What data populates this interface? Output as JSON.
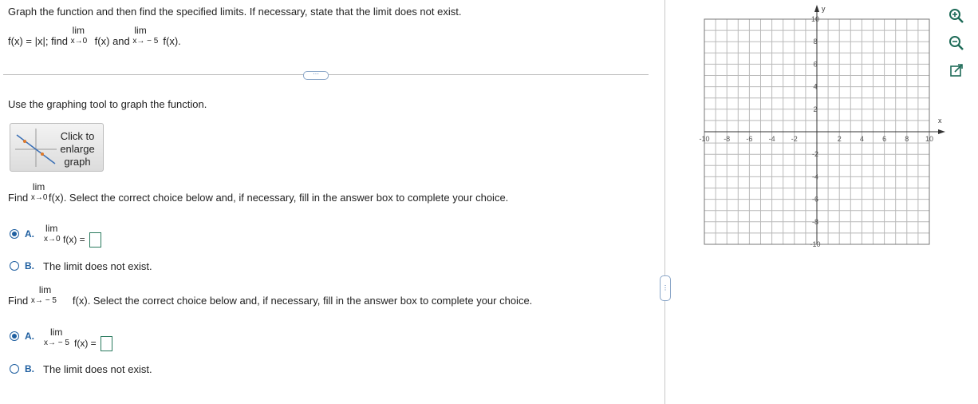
{
  "question": {
    "instruction": "Graph the function and then find the specified limits. If necessary, state that the limit does not exist.",
    "func_prefix": "f(x) = |x|; find",
    "lim_word": "lim",
    "fx": "f(x)",
    "and_word": "and",
    "fx_end": "f(x).",
    "approach_0": "x→0",
    "approach_m5": "x→ − 5"
  },
  "divider_label": "···",
  "graph_tool_text": "Use the graphing tool to graph the function.",
  "thumbnail": {
    "line1": "Click to",
    "line2": "enlarge",
    "line3": "graph"
  },
  "part1": {
    "find_word": "Find",
    "prompt_rest": "f(x). Select the correct choice below and, if necessary, fill in the answer box to complete your choice.",
    "option_a_letter": "A.",
    "option_a_fx": "f(x) =",
    "option_b_letter": "B.",
    "option_b_text": "The limit does not exist.",
    "selected": "A"
  },
  "part2": {
    "find_word": "Find",
    "prompt_rest": "f(x). Select the correct choice below and, if necessary, fill in the answer box to complete your choice.",
    "option_a_letter": "A.",
    "option_a_fx": "f(x) =",
    "option_b_letter": "B.",
    "option_b_text": "The limit does not exist.",
    "selected": "A"
  },
  "graph": {
    "x_label": "x",
    "y_label": "y",
    "x_ticks": [
      "-10",
      "-8",
      "-6",
      "-4",
      "-2",
      "2",
      "4",
      "6",
      "8",
      "10"
    ],
    "y_ticks": [
      "10",
      "8",
      "6",
      "4",
      "2",
      "-2",
      "-4",
      "-6",
      "-8",
      "-10"
    ]
  },
  "toolbar": [
    "zoom-in-icon",
    "zoom-out-icon",
    "popout-icon"
  ]
}
